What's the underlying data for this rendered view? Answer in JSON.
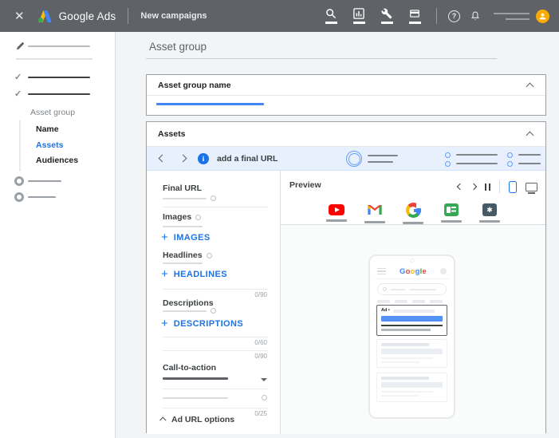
{
  "topbar": {
    "brand": "Google Ads",
    "subtitle": "New campaigns"
  },
  "icons": {
    "close": "✕",
    "help": "?",
    "check": "✓",
    "plus": "+",
    "info": "i",
    "discover": "✱"
  },
  "sidebar": {
    "step_asset_group": "Asset group",
    "sub_name": "Name",
    "sub_assets": "Assets",
    "sub_audiences": "Audiences"
  },
  "main": {
    "title": "Asset group"
  },
  "asset_group_name_card": {
    "header": "Asset group name"
  },
  "assets_card": {
    "header": "Assets",
    "info_bar_text": "add a final URL",
    "form": {
      "final_url_label": "Final URL",
      "images_label": "Images",
      "add_images": "IMAGES",
      "headlines_label": "Headlines",
      "add_headlines": "HEADLINES",
      "headlines_counter": "0/90",
      "descriptions_label": "Descriptions",
      "add_descriptions": "DESCRIPTIONS",
      "descriptions_counter_1": "0/60",
      "descriptions_counter_2": "0/90",
      "cta_label": "Call-to-action",
      "business_name_counter": "0/25",
      "ad_url_options_label": "Ad URL options"
    },
    "preview": {
      "label": "Preview",
      "phone_logo": "Google",
      "logo_colors": [
        "#4285f4",
        "#ea4335",
        "#fbbc05",
        "#4285f4",
        "#34a853",
        "#ea4335"
      ],
      "ad_badge": "Ad •"
    }
  },
  "colors": {
    "topbar_bg": "#5f6368",
    "accent_blue": "#1a73e8",
    "info_bar_bg": "#e8f0fe",
    "avatar_bg": "#f9ab00",
    "page_bg": "#f2f4f5"
  }
}
